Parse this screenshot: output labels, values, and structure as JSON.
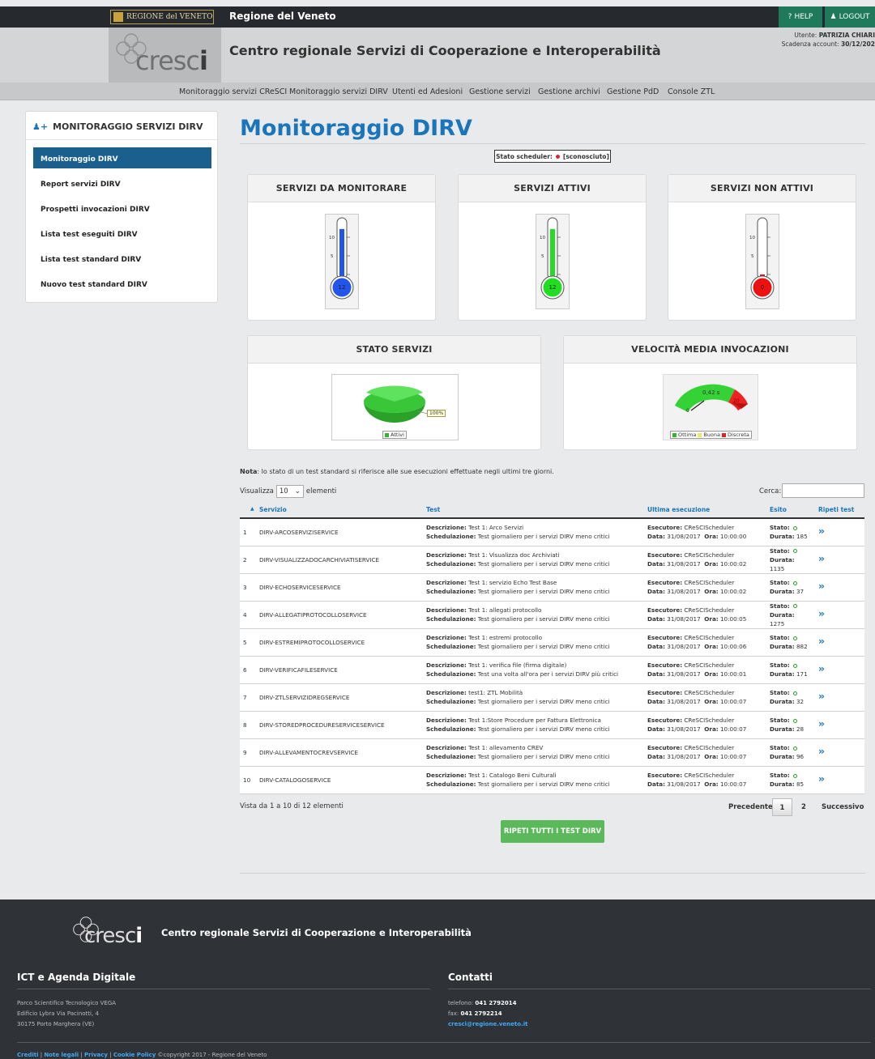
{
  "topbar": {
    "logo_text": "REGIONE del VENETO",
    "region_title": "Regione del Veneto",
    "help_label": "HELP",
    "logout_label": "LOGOUT"
  },
  "header": {
    "logo_text_light": "cresc",
    "logo_text_dark": "i",
    "app_title": "Centro regionale Servizi di Cooperazione e Interoperabilità",
    "user_label": "Utente:",
    "user_name": "PATRIZIA CHIARI",
    "expiry_label": "Scadenza account:",
    "expiry_date": "30/12/202"
  },
  "nav": {
    "items": [
      "Monitoraggio servizi CReSCI",
      "Monitoraggio servizi DIRV",
      "Utenti ed Adesioni",
      "Gestione servizi",
      "Gestione archivi",
      "Gestione PdD",
      "Console ZTL"
    ]
  },
  "sidebar": {
    "title": "MONITORAGGIO SERVIZI DIRV",
    "items": [
      "Monitoraggio DIRV",
      "Report servizi DIRV",
      "Prospetti invocazioni DIRV",
      "Lista test eseguiti DIRV",
      "Lista test standard DIRV",
      "Nuovo test standard DIRV"
    ]
  },
  "main": {
    "title": "Monitoraggio DIRV",
    "scheduler_label": "Stato scheduler:",
    "scheduler_value": "[sconosciuto]"
  },
  "panels": {
    "to_monitor": {
      "title": "SERVIZI DA MONITORARE",
      "value": "12",
      "ticks": [
        "10",
        "5"
      ],
      "color": "#2255ee",
      "fill": 0.85
    },
    "active": {
      "title": "SERVIZI ATTIVI",
      "value": "12",
      "ticks": [
        "10",
        "5"
      ],
      "color": "#22dd22",
      "fill": 0.85
    },
    "inactive": {
      "title": "SERVIZI NON ATTIVI",
      "value": "0",
      "ticks": [
        "10",
        "5"
      ],
      "color": "#ee1111",
      "fill": 0.0
    },
    "status": {
      "title": "STATO SERVIZI",
      "pct_label": "100%",
      "legend": "Attivi"
    },
    "speed": {
      "title": "VELOCITÀ MEDIA INVOCAZIONI",
      "value_label": "0,42 s",
      "left_label": "0",
      "right_label": "20",
      "legend": [
        "Ottima",
        "Buona",
        "Discreta"
      ]
    }
  },
  "table": {
    "note_prefix": "Nota",
    "note_text": ": lo stato di un test standard si riferisce alle sue esecuzioni effettuate negli ultimi tre giorni.",
    "show_label": "Visualizza",
    "show_value": "10",
    "show_suffix": "elementi",
    "search_label": "Cerca:",
    "headers": [
      "Servizio",
      "Test",
      "Ultima esecuzione",
      "Esito",
      "Ripeti test"
    ],
    "labels": {
      "desc": "Descrizione:",
      "sched": "Schedulazione:",
      "exec": "Esecutore:",
      "date": "Data:",
      "time": "Ora:",
      "state": "Stato:",
      "duration": "Durata:"
    },
    "rows": [
      {
        "n": "1",
        "service": "DIRV-ARCOSERVIZISERVICE",
        "desc": "Test 1: Arco Servizi",
        "sched": "Test giornaliero per i servizi DIRV meno critici",
        "exec": "CReSCIScheduler",
        "date": "31/08/2017",
        "time": "10:00:00",
        "duration": "185"
      },
      {
        "n": "2",
        "service": "DIRV-VISUALIZZADOCARCHIVIATISERVICE",
        "desc": "Test 1: Visualizza doc Archiviati",
        "sched": "Test giornaliero per i servizi DIRV meno critici",
        "exec": "CReSCIScheduler",
        "date": "31/08/2017",
        "time": "10:00:02",
        "duration": "1135"
      },
      {
        "n": "3",
        "service": "DIRV-ECHOSERVICESERVICE",
        "desc": "Test 1: servizio Echo Test Base",
        "sched": "Test giornaliero per i servizi DIRV meno critici",
        "exec": "CReSCIScheduler",
        "date": "31/08/2017",
        "time": "10:00:02",
        "duration": "37"
      },
      {
        "n": "4",
        "service": "DIRV-ALLEGATIPROTOCOLLOSERVICE",
        "desc": "Test 1: allegati protocollo",
        "sched": "Test giornaliero per i servizi DIRV meno critici",
        "exec": "CReSCIScheduler",
        "date": "31/08/2017",
        "time": "10:00:05",
        "duration": "1275"
      },
      {
        "n": "5",
        "service": "DIRV-ESTREMIPROTOCOLLOSERVICE",
        "desc": "Test 1: estremi protocollo",
        "sched": "Test giornaliero per i servizi DIRV meno critici",
        "exec": "CReSCIScheduler",
        "date": "31/08/2017",
        "time": "10:00:06",
        "duration": "882"
      },
      {
        "n": "6",
        "service": "DIRV-VERIFICAFILESERVICE",
        "desc": "Test 1: verifica file (firma digitale)",
        "sched": "Test una volta all'ora per i servizi DIRV più critici",
        "exec": "CReSCIScheduler",
        "date": "31/08/2017",
        "time": "10:00:01",
        "duration": "171"
      },
      {
        "n": "7",
        "service": "DIRV-ZTLSERVIZIDREGSERVICE",
        "desc": "test1: ZTL Mobilità",
        "sched": "Test giornaliero per i servizi DIRV meno critici",
        "exec": "CReSCIScheduler",
        "date": "31/08/2017",
        "time": "10:00:07",
        "duration": "32"
      },
      {
        "n": "8",
        "service": "DIRV-STOREDPROCEDURESERVICESERVICE",
        "desc": "Test 1:Store Procedure per Fattura Elettronica",
        "sched": "Test giornaliero per i servizi DIRV meno critici",
        "exec": "CReSCIScheduler",
        "date": "31/08/2017",
        "time": "10:00:07",
        "duration": "28"
      },
      {
        "n": "9",
        "service": "DIRV-ALLEVAMENTOCREVSERVICE",
        "desc": "Test 1: allevamento CREV",
        "sched": "Test giornaliero per i servizi DIRV meno critici",
        "exec": "CReSCIScheduler",
        "date": "31/08/2017",
        "time": "10:00:07",
        "duration": "96"
      },
      {
        "n": "10",
        "service": "DIRV-CATALOGOSERVICE",
        "desc": "Test 1: Catalogo Beni Culturali",
        "sched": "Test giornaliero per i servizi DIRV meno critici",
        "exec": "CReSCIScheduler",
        "date": "31/08/2017",
        "time": "10:00:07",
        "duration": "85"
      }
    ],
    "info": "Vista da 1 a 10 di 12 elementi",
    "prev": "Precedente",
    "page1": "1",
    "page2": "2",
    "next": "Successivo",
    "repeat_all": "RIPETI TUTTI I TEST DIRV"
  },
  "footer": {
    "logo_light": "cresc",
    "logo_dark": "i",
    "title": "Centro regionale Servizi di Cooperazione e Interoperabilità",
    "left_heading": "ICT e Agenda Digitale",
    "address": [
      "Parco Scientifico Tecnologico VEGA",
      "Edificio Lybra Via Pacinotti, 4",
      "30175 Porto Marghera (VE)"
    ],
    "right_heading": "Contatti",
    "phone_label": "telefono:",
    "phone": "041 2792014",
    "fax_label": "fax:",
    "fax": "041 2792214",
    "email": "cresci@regione.veneto.it",
    "links": [
      "Crediti",
      "Note legali",
      "Privacy",
      "Cookie Policy"
    ],
    "copyright": "©copyright 2017 - Regione del Veneto"
  }
}
